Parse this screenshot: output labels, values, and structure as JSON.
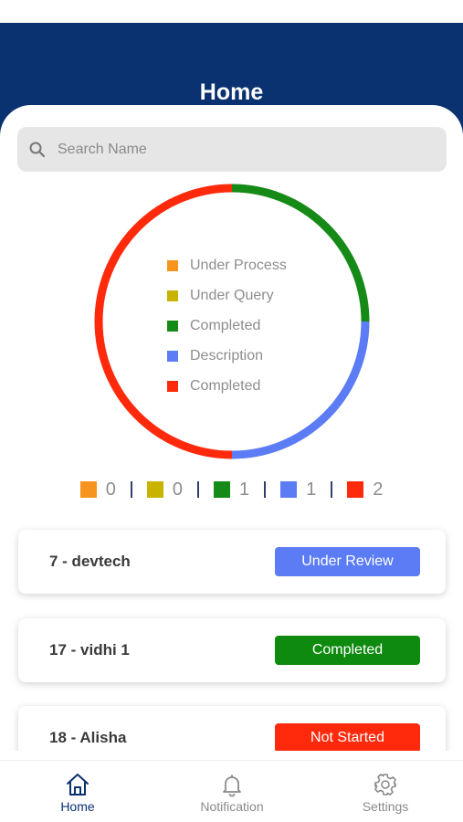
{
  "header": {
    "title": "Home"
  },
  "search": {
    "placeholder": "Search Name",
    "icon": "search-icon"
  },
  "chart_data": {
    "type": "pie",
    "donut": true,
    "categories": [
      "Under Process",
      "Under Query",
      "Completed",
      "Description",
      "Completed"
    ],
    "values": [
      0,
      0,
      1,
      1,
      2
    ],
    "colors": [
      "#f7941d",
      "#c8b400",
      "#168a16",
      "#5b7cf4",
      "#ff2a0c"
    ]
  },
  "legend": [
    {
      "label": "Under Process",
      "color": "#f7941d"
    },
    {
      "label": "Under Query",
      "color": "#c8b400"
    },
    {
      "label": "Completed",
      "color": "#168a16"
    },
    {
      "label": "Description",
      "color": "#5b7cf4"
    },
    {
      "label": "Completed",
      "color": "#ff2a0c"
    }
  ],
  "counts": [
    {
      "value": "0",
      "color": "#f7941d"
    },
    {
      "value": "0",
      "color": "#c8b400"
    },
    {
      "value": "1",
      "color": "#168a16"
    },
    {
      "value": "1",
      "color": "#5b7cf4"
    },
    {
      "value": "2",
      "color": "#ff2a0c"
    }
  ],
  "items": [
    {
      "title": "7 - devtech",
      "status": "Under Review",
      "status_color": "#5b7cf4"
    },
    {
      "title": "17 - vidhi 1",
      "status": "Completed",
      "status_color": "#0e8a0e"
    },
    {
      "title": "18 - Alisha",
      "status": "Not Started",
      "status_color": "#ff2a0c"
    }
  ],
  "tabs": [
    {
      "label": "Home",
      "icon": "home-icon",
      "active": true
    },
    {
      "label": "Notification",
      "icon": "bell-icon",
      "active": false
    },
    {
      "label": "Settings",
      "icon": "gear-icon",
      "active": false
    }
  ],
  "colors": {
    "header_bg": "#0a3170",
    "active_tab": "#0a3170",
    "inactive_tab": "#8a8a8a"
  }
}
